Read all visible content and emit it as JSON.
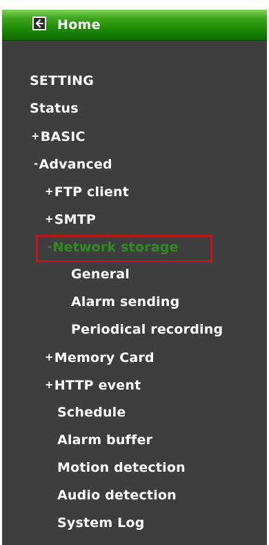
{
  "header": {
    "home_label": "Home",
    "home_icon": "back-arrow-icon"
  },
  "colors": {
    "panel_bg": "#3e3e3e",
    "header_green": "#1f8a06",
    "text": "#ffffff",
    "active_text": "#2d8c20",
    "active_border": "#c1151b"
  },
  "menu": {
    "setting": {
      "label": "SETTING"
    },
    "status": {
      "label": "Status"
    },
    "basic": {
      "prefix": "+",
      "label": "BASIC"
    },
    "advanced": {
      "prefix": "-",
      "label": "Advanced"
    },
    "ftp": {
      "prefix": "+",
      "label": "FTP client"
    },
    "smtp": {
      "prefix": "+",
      "label": "SMTP"
    },
    "network_storage": {
      "prefix": "-",
      "label": "Network storage",
      "active": true
    },
    "general": {
      "label": "General"
    },
    "alarm_sending": {
      "label": "Alarm sending"
    },
    "periodical_recording": {
      "label": "Periodical recording"
    },
    "memory_card": {
      "prefix": "+",
      "label": "Memory Card"
    },
    "http_event": {
      "prefix": "+",
      "label": "HTTP event"
    },
    "schedule": {
      "label": "Schedule"
    },
    "alarm_buffer": {
      "label": "Alarm buffer"
    },
    "motion_detection": {
      "label": "Motion detection"
    },
    "audio_detection": {
      "label": "Audio detection"
    },
    "system_log": {
      "label": "System Log"
    }
  }
}
